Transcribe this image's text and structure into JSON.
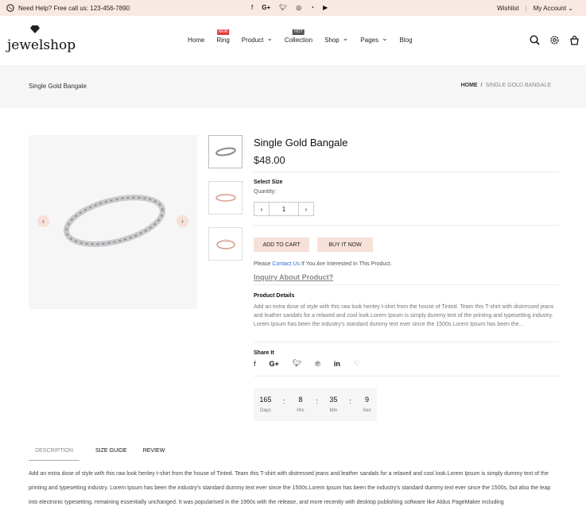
{
  "topbar": {
    "help_text": "Need Help? Free call us: 123-456-7890",
    "social_icons": [
      "facebook-icon",
      "google-plus-icon",
      "twitter-icon",
      "instagram-icon",
      "rss-icon",
      "youtube-icon"
    ],
    "wishlist": "Wishlist",
    "separator": "|",
    "account": "My Account"
  },
  "header": {
    "logo": "jewelshop",
    "nav": [
      {
        "label": "Home",
        "badge": "",
        "dropdown": false
      },
      {
        "label": "Ring",
        "badge": "NEW",
        "dropdown": false
      },
      {
        "label": "Product",
        "badge": "",
        "dropdown": true
      },
      {
        "label": "Collection",
        "badge": "HOT",
        "dropdown": false
      },
      {
        "label": "Shop",
        "badge": "",
        "dropdown": true
      },
      {
        "label": "Pages",
        "badge": "",
        "dropdown": true
      },
      {
        "label": "Blog",
        "badge": "",
        "dropdown": false
      }
    ]
  },
  "banner": {
    "title": "Single Gold Bangale",
    "crumb_home": "HOME",
    "crumb_sep": "/",
    "crumb_current": "SINGLE GOLD BANGALE"
  },
  "product": {
    "title": "Single Gold Bangale",
    "price": "$48.00",
    "select_size": "Select Size",
    "quantity_label": "Quantity:",
    "quantity": "1",
    "add_to_cart": "ADD TO CART",
    "buy_now": "BUY IT NOW",
    "please_prefix": "Please",
    "contact": "Contact Us",
    "please_suffix": "If You Are Interested In This Product.",
    "inquiry": "Inquiry About Product?",
    "details_heading": "Product Details",
    "details": "Add an extra dose of style with this raw look henley t-shirt from the house of Tinted. Team this T-shirt with distressed jeans and leather sandals for a relaxed and cool look.Lorem Ipsum is simply dummy text of the printing and typesetting industry. Lorem Ipsum has been the industry's standard dummy text ever since the 1500s.Lorem Ipsum has been the...",
    "share_heading": "Share It"
  },
  "timer": {
    "days": "165",
    "hrs": "8",
    "min": "35",
    "sec": "9",
    "days_label": "Days",
    "hrs_label": "Hrs",
    "min_label": "Min",
    "sec_label": "Sec",
    "sep": ":"
  },
  "tabs": [
    "DESCRIPTION",
    "SIZE GUIDE",
    "REVIEW"
  ],
  "description": "Add an extra dose of style with this raw look henley t-shirt from the house of Tinted. Team this T-shirt with distressed jeans and leather sandals for a relaxed and cool look.Lorem Ipsum is simply dummy text of the printing and typesetting industry. Lorem Ipsum has been the industry's standard dummy text ever since the 1500s.Lorem Ipsum has been the industry's standard dummy text ever since the 1500s, but also the leap into electronic typesetting, remaining essentially unchanged. It was popularised in the 1960s with the release, and more recently with desktop publishing software like Aldus PageMaker including",
  "colors": {
    "accent": "#f7e0d8",
    "topbar": "#f9e9e3",
    "link": "#2a6fd6"
  }
}
